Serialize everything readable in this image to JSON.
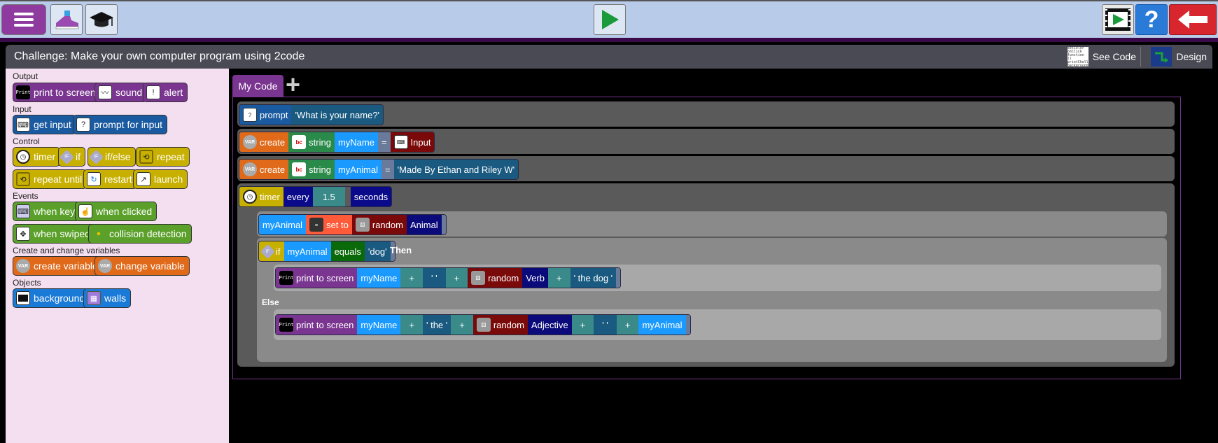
{
  "header": {
    "title": "Challenge: Make your own computer program using 2code",
    "see_code_label": "See Code",
    "design_label": "Design",
    "see_code_thumb": "setColor onClick function () printChello background",
    "help_glyph": "?"
  },
  "icons": {
    "menu": "menu-icon",
    "shoe": "shoe-icon",
    "cap": "graduation-cap-icon",
    "play": "play-icon",
    "film": "film-icon",
    "help": "help-icon",
    "back": "back-arrow-icon"
  },
  "palette": {
    "categories": {
      "output": "Output",
      "input": "Input",
      "control": "Control",
      "events": "Events",
      "variables": "Create and change variables",
      "objects": "Objects"
    },
    "blocks": {
      "print": "print to screen",
      "sound": "sound",
      "alert": "alert",
      "get_input": "get input",
      "prompt_for_input": "prompt for input",
      "timer": "timer",
      "if": "if",
      "if_else": "if/else",
      "repeat": "repeat",
      "repeat_until": "repeat until",
      "restart": "restart",
      "launch": "launch",
      "when_key": "when key",
      "when_clicked": "when clicked",
      "when_swiped": "when swiped",
      "collision": "collision detection",
      "create_variable": "create variable",
      "change_variable": "change variable",
      "background": "background",
      "walls": "walls"
    },
    "icon_text": {
      "print": "Print",
      "if": "IF",
      "var": "VAR"
    }
  },
  "editor": {
    "tab_label": "My Code",
    "add_tab_glyph": "+",
    "code": {
      "prompt_kw": "prompt",
      "prompt_str": "'What is your name?'",
      "create_kw": "create",
      "string_kw": "string",
      "var1": "myName",
      "eq": "=",
      "input_kw": "Input",
      "var2": "myAnimal",
      "str2": "'Made By Ethan and Riley W'",
      "timer_kw": "timer",
      "every_kw": "every",
      "interval": "1.5",
      "seconds_kw": "seconds",
      "set_kw": "set to",
      "random_kw": "random",
      "animal_list": "Animal",
      "if_kw": "if",
      "equals_kw": "equals",
      "dog_str": "'dog'",
      "then_kw": "Then",
      "else_kw": "Else",
      "print_kw": "print to screen",
      "plus": "+",
      "space_str": "' '",
      "verb_list": "Verb",
      "the_dog_str": "' the dog '",
      "the_str": "' the '",
      "adjective_list": "Adjective"
    }
  }
}
